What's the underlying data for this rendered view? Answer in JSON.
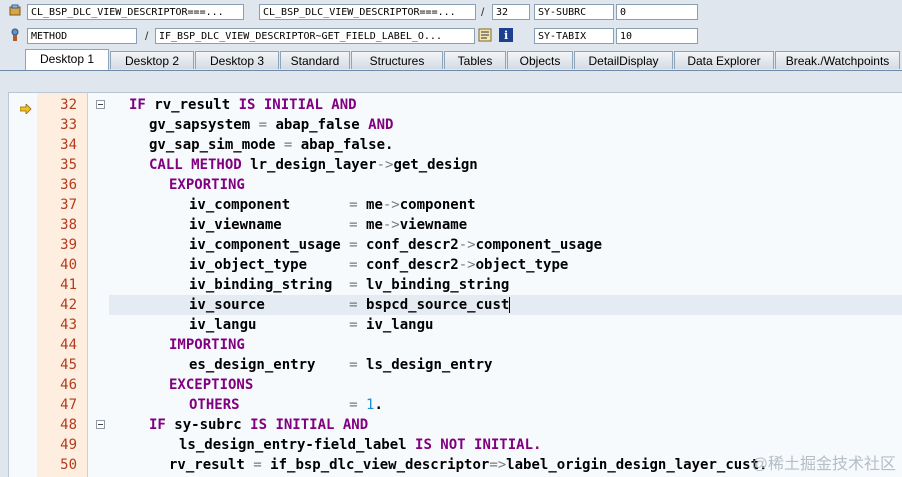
{
  "header": {
    "row1": {
      "field1": "CL_BSP_DLC_VIEW_DESCRIPTOR===...",
      "field2": "CL_BSP_DLC_VIEW_DESCRIPTOR===...",
      "sep": "/",
      "field3": "32",
      "sysvar_label": "SY-SUBRC",
      "sysvar_value": "0"
    },
    "row2": {
      "field1": "METHOD",
      "field2": "IF_BSP_DLC_VIEW_DESCRIPTOR~GET_FIELD_LABEL_O...",
      "sep": "/",
      "sysvar_label": "SY-TABIX",
      "sysvar_value": "10"
    }
  },
  "tabs": [
    {
      "label": "Desktop 1",
      "active": true
    },
    {
      "label": "Desktop 2"
    },
    {
      "label": "Desktop 3"
    },
    {
      "label": "Standard"
    },
    {
      "label": "Structures"
    },
    {
      "label": "Tables"
    },
    {
      "label": "Objects"
    },
    {
      "label": "DetailDisplay"
    },
    {
      "label": "Data Explorer"
    },
    {
      "label": "Break./Watchpoints"
    }
  ],
  "editor": {
    "current_line": "32",
    "lines": [
      {
        "n": "32",
        "t": [
          [
            "k",
            "IF "
          ],
          [
            "t",
            "rv_result "
          ],
          [
            "k",
            "IS INITIAL AND"
          ]
        ],
        "indent": 0
      },
      {
        "n": "33",
        "t": [
          [
            "t",
            "gv_sapsystem "
          ],
          [
            "o",
            "= "
          ],
          [
            "t",
            "abap_false "
          ],
          [
            "k",
            "AND"
          ]
        ],
        "indent": 1
      },
      {
        "n": "34",
        "t": [
          [
            "t",
            "gv_sap_sim_mode "
          ],
          [
            "o",
            "= "
          ],
          [
            "t",
            "abap_false."
          ]
        ],
        "indent": 1
      },
      {
        "n": "35",
        "t": [
          [
            "k",
            "CALL METHOD "
          ],
          [
            "t",
            "lr_design_layer"
          ],
          [
            "o",
            "->"
          ],
          [
            "t",
            "get_design"
          ]
        ],
        "indent": 1
      },
      {
        "n": "36",
        "t": [
          [
            "k",
            "EXPORTING"
          ]
        ],
        "indent": 2
      },
      {
        "n": "37",
        "t": [
          [
            "t",
            "iv_component       "
          ],
          [
            "o",
            "= "
          ],
          [
            "t",
            "me"
          ],
          [
            "o",
            "->"
          ],
          [
            "t",
            "component"
          ]
        ],
        "indent": 3
      },
      {
        "n": "38",
        "t": [
          [
            "t",
            "iv_viewname        "
          ],
          [
            "o",
            "= "
          ],
          [
            "t",
            "me"
          ],
          [
            "o",
            "->"
          ],
          [
            "t",
            "viewname"
          ]
        ],
        "indent": 3
      },
      {
        "n": "39",
        "t": [
          [
            "t",
            "iv_component_usage "
          ],
          [
            "o",
            "= "
          ],
          [
            "t",
            "conf_descr2"
          ],
          [
            "o",
            "->"
          ],
          [
            "t",
            "component_usage"
          ]
        ],
        "indent": 3
      },
      {
        "n": "40",
        "t": [
          [
            "t",
            "iv_object_type     "
          ],
          [
            "o",
            "= "
          ],
          [
            "t",
            "conf_descr2"
          ],
          [
            "o",
            "->"
          ],
          [
            "t",
            "object_type"
          ]
        ],
        "indent": 3
      },
      {
        "n": "41",
        "t": [
          [
            "t",
            "iv_binding_string  "
          ],
          [
            "o",
            "= "
          ],
          [
            "t",
            "lv_binding_string"
          ]
        ],
        "indent": 3
      },
      {
        "n": "42",
        "t": [
          [
            "t",
            "iv_source          "
          ],
          [
            "o",
            "= "
          ],
          [
            "t",
            "bspcd_source_cust"
          ]
        ],
        "indent": 3
      },
      {
        "n": "43",
        "t": [
          [
            "t",
            "iv_langu           "
          ],
          [
            "o",
            "= "
          ],
          [
            "t",
            "iv_langu"
          ]
        ],
        "indent": 3
      },
      {
        "n": "44",
        "t": [
          [
            "k",
            "IMPORTING"
          ]
        ],
        "indent": 2
      },
      {
        "n": "45",
        "t": [
          [
            "t",
            "es_design_entry    "
          ],
          [
            "o",
            "= "
          ],
          [
            "t",
            "ls_design_entry"
          ]
        ],
        "indent": 3
      },
      {
        "n": "46",
        "t": [
          [
            "k",
            "EXCEPTIONS"
          ]
        ],
        "indent": 2
      },
      {
        "n": "47",
        "t": [
          [
            "k",
            "OTHERS             "
          ],
          [
            "o",
            "= "
          ],
          [
            "n",
            "1"
          ],
          [
            "t",
            "."
          ]
        ],
        "indent": 3
      },
      {
        "n": "48",
        "t": [
          [
            "k",
            "IF "
          ],
          [
            "t",
            "sy-subrc "
          ],
          [
            "k",
            "IS INITIAL AND"
          ]
        ],
        "indent": 1
      },
      {
        "n": "49",
        "t": [
          [
            "t",
            "ls_design_entry-field_label "
          ],
          [
            "k",
            "IS NOT INITIAL."
          ]
        ],
        "indent": 2.5
      },
      {
        "n": "50",
        "t": [
          [
            "t",
            "rv_result "
          ],
          [
            "o",
            "= "
          ],
          [
            "t",
            "if_bsp_dlc_view_descriptor"
          ],
          [
            "o",
            "=>"
          ],
          [
            "t",
            "label_origin_design_layer_cust."
          ]
        ],
        "indent": 2
      }
    ]
  },
  "watermark": "@稀土掘金技术社区",
  "icons": {
    "execution-arrow": "arrow-right-icon",
    "fold": "collapse-icon",
    "source-icon": "source-code-icon",
    "info-icon": "info-icon"
  }
}
